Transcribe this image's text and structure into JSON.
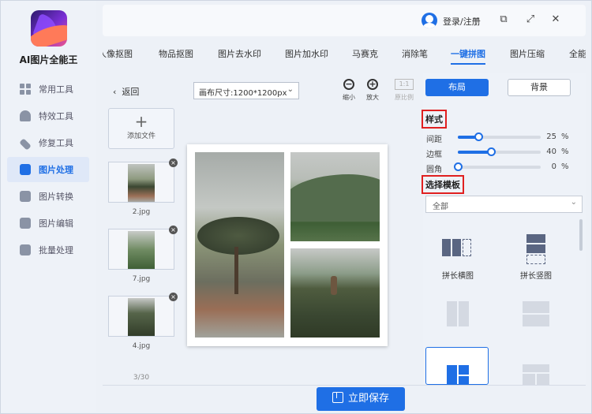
{
  "app": {
    "name": "AI图片全能王"
  },
  "window": {
    "login": "登录/注册",
    "minimize": "−",
    "restore": "⧉",
    "maximize": "⤢",
    "close": "✕"
  },
  "sidebar": {
    "items": [
      {
        "label": "常用工具",
        "icon": "grid-icon"
      },
      {
        "label": "特效工具",
        "icon": "bell-icon"
      },
      {
        "label": "修复工具",
        "icon": "bandage-icon"
      },
      {
        "label": "图片处理",
        "icon": "image-icon",
        "active": true
      },
      {
        "label": "图片转换",
        "icon": "convert-icon"
      },
      {
        "label": "图片编辑",
        "icon": "edit-icon"
      },
      {
        "label": "批量处理",
        "icon": "upload-icon"
      }
    ]
  },
  "tabs": [
    "人像抠图",
    "物品抠图",
    "图片去水印",
    "图片加水印",
    "马赛克",
    "消除笔",
    "一键拼图",
    "图片压缩",
    "全能"
  ],
  "active_tab": "一键拼图",
  "files": {
    "back": "返回",
    "add_file": "添加文件",
    "remove": "×",
    "items": [
      {
        "name": "2.jpg"
      },
      {
        "name": "7.jpg"
      },
      {
        "name": "4.jpg"
      }
    ],
    "count": "3/30"
  },
  "canvas": {
    "size_label": "画布尺寸:1200*1200px",
    "zoom_out": "缩小",
    "zoom_in": "放大",
    "ratio_label": "原比例",
    "ratio_value": "1:1"
  },
  "panel": {
    "tab_layout": "布局",
    "tab_background": "背景",
    "style_title": "样式",
    "sliders": [
      {
        "label": "间距",
        "value": 25,
        "unit": "%"
      },
      {
        "label": "边框",
        "value": 40,
        "unit": "%"
      },
      {
        "label": "圆角",
        "value": 0,
        "unit": "%"
      }
    ],
    "template_title": "选择模板",
    "template_filter": "全部",
    "templates": [
      {
        "label": "拼长横图"
      },
      {
        "label": "拼长竖图"
      }
    ]
  },
  "save_button": "立即保存",
  "colors": {
    "accent": "#1f6fe5",
    "highlight_box": "#e02020"
  }
}
